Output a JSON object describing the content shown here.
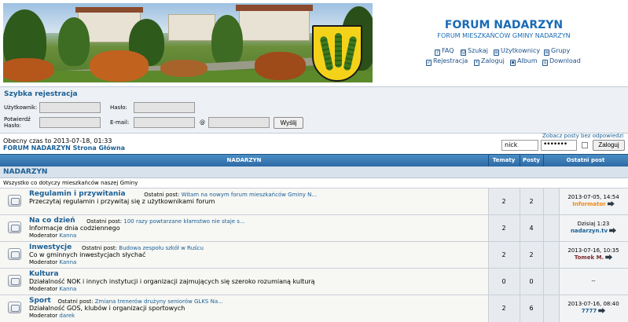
{
  "site": {
    "title": "FORUM NADARZYN",
    "description": "FORUM MIESZKAŃCÓW GMINY NADARZYN"
  },
  "nav": [
    {
      "label": "FAQ",
      "icon": "faq-icon"
    },
    {
      "label": "Szukaj",
      "icon": "search-icon"
    },
    {
      "label": "Użytkownicy",
      "icon": "users-icon"
    },
    {
      "label": "Grupy",
      "icon": "groups-icon"
    },
    {
      "label": "Rejestracja",
      "icon": "register-icon"
    },
    {
      "label": "Zaloguj",
      "icon": "login-icon"
    },
    {
      "label": "Album",
      "icon": "album-icon"
    },
    {
      "label": "Download",
      "icon": "download-icon"
    }
  ],
  "quick_register": {
    "title": "Szybka rejestracja",
    "user_label": "Użytkownik:",
    "password_label": "Hasło:",
    "confirm_label_1": "Potwierdź",
    "confirm_label_2": "Hasło:",
    "email_label": "E-mail:",
    "at": "@",
    "send_label": "Wyślij"
  },
  "status": {
    "time": "Obecny czas to 2013-07-18, 01:33",
    "home_link": "FORUM NADARZYN Strona Główna",
    "unanswered_link": "Zobacz posty bez odpowiedzi"
  },
  "login": {
    "username": "nick",
    "password_mask": "•••••••",
    "button": "Zaloguj"
  },
  "table": {
    "headers": [
      "NADARZYN",
      "Tematy",
      "Posty",
      "Ostatni post"
    ]
  },
  "category": {
    "name": "NADARZYN",
    "description": "Wszystko co dotyczy mieszkańców naszej Gminy"
  },
  "forums": [
    {
      "name": "Regulamin i przywitania",
      "last_post_label": "Ostatni post:",
      "last_post_title": "Witam na nowym forum mieszkańców Gminy N...",
      "description": "Przeczytaj regulamin i przywitaj się z użytkownikami forum",
      "moderator_label": "",
      "moderator": "",
      "topics": "2",
      "posts": "2",
      "last_date": "2013-07-05, 14:54",
      "last_author": "Informator",
      "last_author_color": "#f08a17"
    },
    {
      "name": "Na co dzień",
      "last_post_label": "Ostatni post:",
      "last_post_title": "100 razy powtarzane kłamstwo nie staje s...",
      "description": "Informacje dnia codziennego",
      "moderator_label": "Moderator",
      "moderator": "Kanna",
      "topics": "2",
      "posts": "4",
      "last_date": "Dzisiaj 1:23",
      "last_author": "nadarzyn.tv",
      "last_author_color": "#1a5f95"
    },
    {
      "name": "Inwestycje",
      "last_post_label": "Ostatni post:",
      "last_post_title": "Budowa zespołu szkół w Ruścu",
      "description": "Co w gminnych inwestycjach słychać",
      "moderator_label": "Moderator",
      "moderator": "Kanna",
      "topics": "2",
      "posts": "2",
      "last_date": "2013-07-16, 10:35",
      "last_author": "Tomek M.",
      "last_author_color": "#7a2c2c"
    },
    {
      "name": "Kultura",
      "last_post_label": "",
      "last_post_title": "",
      "description": "Działalność NOK i innych instytucji i organizacji zajmujących się szeroko rozumianą kulturą",
      "moderator_label": "Moderator",
      "moderator": "Kanna",
      "topics": "0",
      "posts": "0",
      "last_date": "--",
      "last_author": "",
      "last_author_color": "#000000"
    },
    {
      "name": "Sport",
      "last_post_label": "Ostatni post:",
      "last_post_title": "Zmiana trenerów drużyny seniorów GLKS Na...",
      "description": "Działalność GOS, klubów i organizacji sportowych",
      "moderator_label": "Moderator",
      "moderator": "darek",
      "topics": "2",
      "posts": "6",
      "last_date": "2013-07-16, 08:40",
      "last_author": "7777",
      "last_author_color": "#1a5f95"
    }
  ]
}
